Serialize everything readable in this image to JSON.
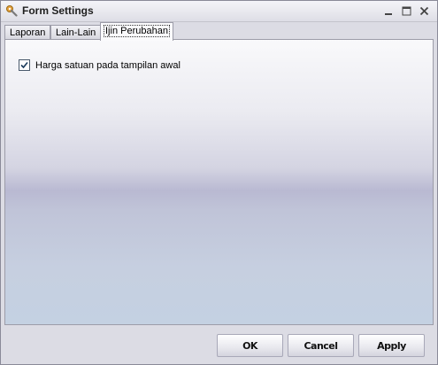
{
  "window": {
    "title": "Form Settings"
  },
  "tabs": [
    {
      "label": "Laporan",
      "active": false
    },
    {
      "label": "Lain-Lain",
      "active": false
    },
    {
      "label": "Ijin Perubahan",
      "active": true
    }
  ],
  "panel": {
    "checkbox": {
      "label": "Harga satuan pada tampilan awal",
      "checked": true
    }
  },
  "buttons": {
    "ok": "OK",
    "cancel": "Cancel",
    "apply": "Apply"
  },
  "icons": {
    "app": "settings-wrench-icon",
    "minimize": "minimize-icon",
    "maximize": "maximize-icon",
    "close": "close-icon",
    "check": "checkmark-icon"
  }
}
